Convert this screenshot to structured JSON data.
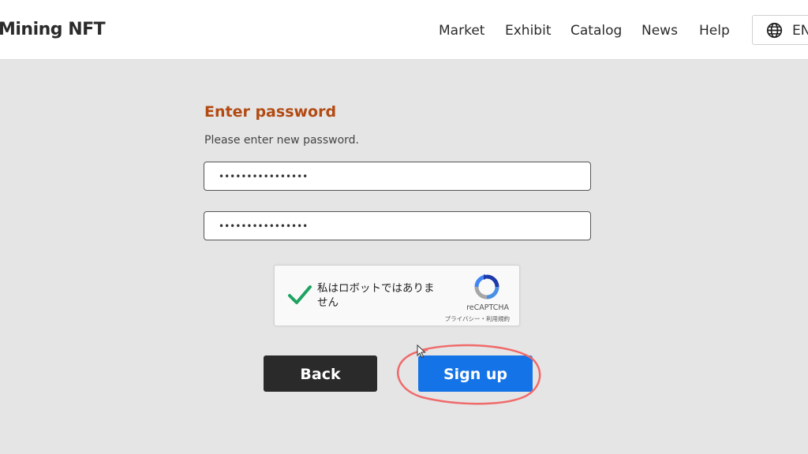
{
  "header": {
    "logo": "Mining NFT",
    "nav": [
      "Market",
      "Exhibit",
      "Catalog",
      "News",
      "Help"
    ],
    "language": "EN"
  },
  "form": {
    "title": "Enter password",
    "subtitle": "Please enter new password.",
    "password_value": "••••••••••••••••",
    "confirm_value": "••••••••••••••••"
  },
  "captcha": {
    "label": "私はロボットではありません",
    "brand": "reCAPTCHA",
    "terms": "プライバシー・利用規約",
    "checked": true
  },
  "buttons": {
    "back": "Back",
    "signup": "Sign up"
  },
  "colors": {
    "title": "#b24a12",
    "signup": "#1473e6",
    "back": "#2a2a2a",
    "check": "#1ea362",
    "annotation": "#f06a6a"
  }
}
